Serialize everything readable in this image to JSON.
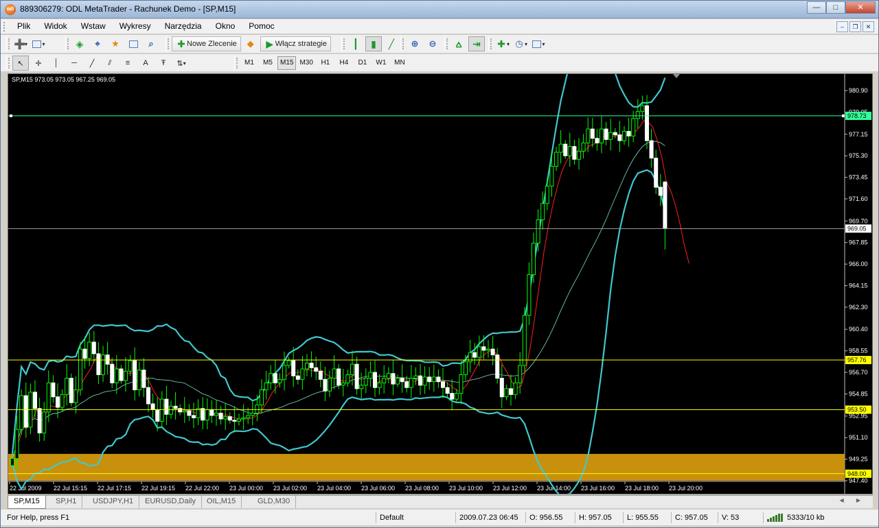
{
  "window": {
    "title": "889306279: ODL MetaTrader - Rachunek Demo - [SP,M15]",
    "app_icon_text": "odl"
  },
  "menu": {
    "items": [
      "Plik",
      "Widok",
      "Wstaw",
      "Wykresy",
      "Narzędzia",
      "Okno",
      "Pomoc"
    ]
  },
  "toolbar": {
    "new_order_label": "Nowe Zlecenie",
    "enable_strategies_label": "Włącz strategie"
  },
  "timeframes": [
    "M1",
    "M5",
    "M15",
    "M30",
    "H1",
    "H4",
    "D1",
    "W1",
    "MN"
  ],
  "active_timeframe": "M15",
  "chart": {
    "info": "SP,M15  973.05 973.05 967.25 969.05",
    "background": "#000000",
    "candle_color": "#ffffff",
    "wick_color": "#00ff00",
    "bollinger_color": "#40c8d0",
    "red_ma_color": "#ff2020",
    "slow_ma_color": "#80e0c8",
    "zone_color": "#c8900c"
  },
  "chart_data": {
    "type": "candlestick",
    "symbol": "SP",
    "timeframe": "M15",
    "ohlc": {
      "open": 973.05,
      "high": 973.05,
      "low": 967.25,
      "close": 969.05
    },
    "ylim": [
      947.4,
      982.2
    ],
    "y_ticks": [
      "980.90",
      "979.05",
      "977.15",
      "975.30",
      "973.45",
      "971.60",
      "969.70",
      "967.85",
      "966.00",
      "964.15",
      "962.30",
      "960.40",
      "958.55",
      "956.70",
      "954.85",
      "952.95",
      "951.10",
      "949.25",
      "947.40"
    ],
    "x_ticks": [
      "22 Jul 2009",
      "22 Jul 15:15",
      "22 Jul 17:15",
      "22 Jul 19:15",
      "22 Jul 22:00",
      "23 Jul 00:00",
      "23 Jul 02:00",
      "23 Jul 04:00",
      "23 Jul 06:00",
      "23 Jul 08:00",
      "23 Jul 10:00",
      "23 Jul 12:00",
      "23 Jul 14:00",
      "23 Jul 16:00",
      "23 Jul 18:00",
      "23 Jul 20:00"
    ],
    "horizontal_lines": [
      {
        "label": "978.73",
        "value": 978.73,
        "color": "#33ff99"
      },
      {
        "label": "969.05",
        "value": 969.05,
        "color": "#a0a0a0"
      },
      {
        "label": "957.76",
        "value": 957.76,
        "color": "#ffff00"
      },
      {
        "label": "953.50",
        "value": 953.5,
        "color": "#ffff00"
      },
      {
        "label": "948.00",
        "value": 948.0,
        "color": "#ffff00"
      }
    ],
    "zone": {
      "from": 947.4,
      "to": 949.1
    },
    "closes": [
      949.3,
      951.8,
      954.7,
      952.0,
      955.0,
      953.6,
      951.5,
      953.3,
      955.8,
      954.6,
      953.7,
      954.8,
      956.2,
      954.1,
      955.2,
      958.7,
      957.9,
      959.3,
      958.3,
      956.5,
      958.2,
      957.4,
      955.8,
      957.0,
      956.0,
      956.8,
      957.7,
      955.2,
      956.9,
      955.4,
      954.0,
      953.5,
      952.5,
      954.4,
      953.1,
      953.8,
      953.6,
      953.3,
      953.4,
      953.0,
      952.8,
      953.6,
      952.6,
      953.5,
      953.0,
      953.2,
      952.7,
      952.9,
      952.6,
      952.5,
      952.7,
      952.8,
      953.0,
      953.2,
      953.9,
      955.2,
      955.8,
      956.6,
      955.8,
      956.1,
      957.3,
      957.7,
      956.4,
      956.1,
      957.0,
      957.5,
      957.1,
      956.8,
      956.1,
      955.1,
      956.2,
      957.0,
      955.6,
      955.8,
      956.5,
      957.4,
      955.3,
      955.6,
      956.2,
      956.7,
      955.4,
      955.8,
      956.2,
      956.6,
      955.7,
      956.2,
      955.9,
      955.4,
      956.2,
      956.4,
      955.6,
      956.3,
      955.9,
      956.3,
      955.9,
      955.4,
      954.9,
      954.4,
      954.9,
      956.5,
      957.6,
      958.4,
      958.0,
      958.9,
      958.6,
      958.7,
      958.2,
      956.2,
      954.6,
      955.3,
      954.8,
      955.8,
      957.3,
      961.6,
      965.1,
      967.8,
      969.8,
      971.2,
      972.7,
      974.4,
      975.6,
      976.3,
      975.3,
      976.1,
      975.0,
      975.7,
      976.4,
      977.6,
      976.8,
      976.4,
      977.6,
      976.7,
      977.3,
      977.1,
      976.6,
      977.4,
      977.0,
      978.5,
      979.1,
      979.6,
      976.6,
      975.1,
      972.6,
      971.9,
      969.05
    ],
    "last_price": 969.05
  },
  "tabs": {
    "items": [
      "SP,M15",
      "SP,H1",
      "USDJPY,H1",
      "EURUSD,Daily",
      "OIL,M15",
      "GLD,M30"
    ],
    "active": "SP,M15"
  },
  "status": {
    "help": "For Help, press F1",
    "profile": "Default",
    "datetime": "2009.07.23 06:45",
    "open": "O: 956.55",
    "high": "H: 957.05",
    "low": "L: 955.55",
    "close": "C: 957.05",
    "volume": "V: 53",
    "traffic": "5333/10 kb"
  }
}
